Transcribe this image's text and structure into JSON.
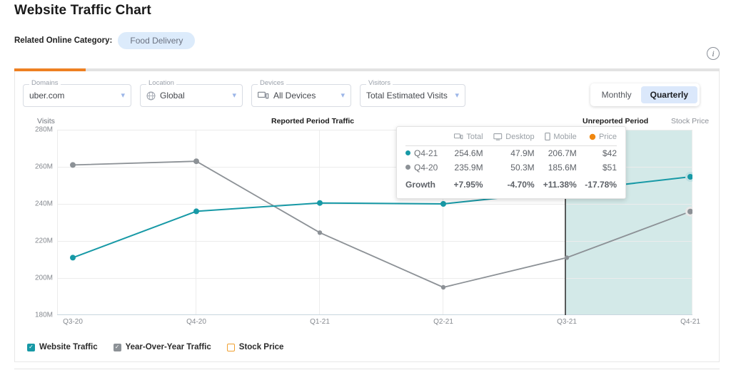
{
  "header": {
    "title": "Website Traffic Chart",
    "category_label": "Related Online Category:",
    "category_value": "Food Delivery",
    "info_icon": "info-icon",
    "info_glyph": "i"
  },
  "filters": [
    {
      "label": "Domains",
      "value": "uber.com",
      "icon": "none",
      "chevron": "chevron-down-icon"
    },
    {
      "label": "Location",
      "value": "Global",
      "icon": "globe-icon",
      "chevron": "chevron-down-icon"
    },
    {
      "label": "Devices",
      "value": "All Devices",
      "icon": "devices-icon",
      "chevron": "chevron-down-icon"
    },
    {
      "label": "Visitors",
      "value": "Total Estimated Visits",
      "icon": "none",
      "chevron": "chevron-down-icon"
    }
  ],
  "granularity": {
    "options": [
      "Monthly",
      "Quarterly"
    ],
    "selected": "Quarterly",
    "monthly_label": "Monthly",
    "quarterly_label": "Quarterly"
  },
  "annotations": {
    "y_axis_name": "Visits",
    "reported_period": "Reported Period Traffic",
    "unreported_period": "Unreported Period",
    "right_axis_name": "Stock Price"
  },
  "tooltip": {
    "columns": [
      "",
      "Total",
      "Desktop",
      "Mobile",
      "Price"
    ],
    "column_icons": [
      "none",
      "devices-icon",
      "desktop-icon",
      "mobile-icon",
      "price-dot-icon"
    ],
    "rows": [
      {
        "label": "Q4-21",
        "dot": "#1799a6",
        "total": "254.6M",
        "desktop": "47.9M",
        "mobile": "206.7M",
        "price": "$42"
      },
      {
        "label": "Q4-20",
        "dot": "#8c9196",
        "total": "235.9M",
        "desktop": "50.3M",
        "mobile": "185.6M",
        "price": "$51"
      }
    ],
    "growth": {
      "label": "Growth",
      "total": "+7.95%",
      "total_sign": "pos",
      "desktop": "-4.70%",
      "desktop_sign": "neg",
      "mobile": "+11.38%",
      "mobile_sign": "pos",
      "price": "-17.78%",
      "price_sign": "neg"
    }
  },
  "legend": [
    {
      "label": "Website Traffic",
      "color": "#1799a6",
      "checked": true,
      "style": "teal"
    },
    {
      "label": "Year-Over-Year Traffic",
      "color": "#8c9196",
      "checked": true,
      "style": "gray"
    },
    {
      "label": "Stock Price",
      "color": "#f0a030",
      "checked": false,
      "style": "orange"
    }
  ],
  "colors": {
    "accent_orange": "#ee8022",
    "website_traffic": "#1799a6",
    "yoy_traffic": "#8c9196",
    "stock_price": "#f0a030",
    "unreported_fill": "#d3e9e8",
    "category_pill": "#dcebfb",
    "positive": "#2ca02c",
    "negative": "#e02020"
  },
  "chart_data": {
    "type": "line",
    "title": "Reported Period Traffic",
    "xlabel": "",
    "ylabel": "Visits",
    "ylim": [
      180000000,
      280000000
    ],
    "ytick_labels": [
      "180M",
      "200M",
      "220M",
      "240M",
      "260M",
      "280M"
    ],
    "ytick_values": [
      180000000,
      200000000,
      220000000,
      240000000,
      260000000,
      280000000
    ],
    "categories": [
      "Q3-20",
      "Q4-20",
      "Q1-21",
      "Q2-21",
      "Q3-21",
      "Q4-21"
    ],
    "grid": true,
    "legend_position": "bottom-left",
    "unreported_period_start_index": 4,
    "series": [
      {
        "name": "Website Traffic",
        "color": "#1799a6",
        "values": [
          211000000,
          236000000,
          240500000,
          240000000,
          247000000,
          254600000
        ],
        "labels": [
          "211M",
          "236M",
          "240.5M",
          "240M",
          "247M",
          "254.6M"
        ]
      },
      {
        "name": "Year-Over-Year Traffic",
        "color": "#8c9196",
        "values": [
          261000000,
          263000000,
          224500000,
          195000000,
          211000000,
          235900000
        ],
        "labels": [
          "261M",
          "263M",
          "224.5M",
          "195M",
          "211M",
          "235.9M"
        ]
      },
      {
        "name": "Stock Price",
        "color": "#f0a030",
        "values": [],
        "labels": [],
        "visible": false
      }
    ],
    "highlighted_category": "Q4-21"
  }
}
